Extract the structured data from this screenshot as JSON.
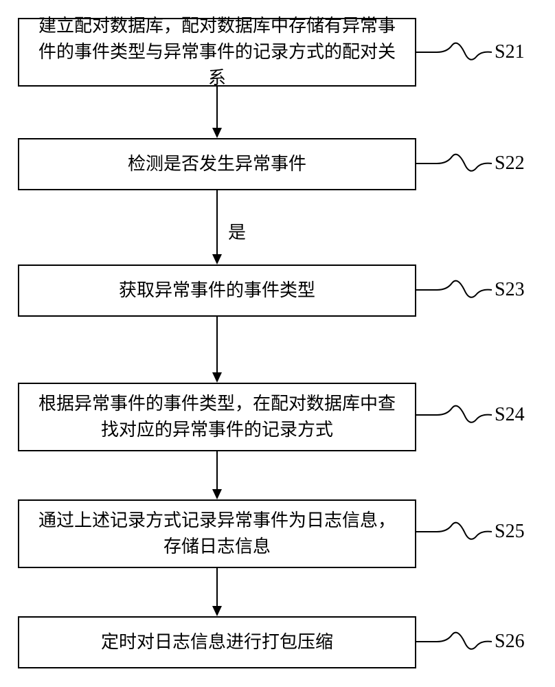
{
  "steps": [
    {
      "id": "S21",
      "text": "建立配对数据库，配对数据库中存储有异常事件的事件类型与异常事件的记录方式的配对关系"
    },
    {
      "id": "S22",
      "text": "检测是否发生异常事件"
    },
    {
      "id": "S23",
      "text": "获取异常事件的事件类型"
    },
    {
      "id": "S24",
      "text": "根据异常事件的事件类型，在配对数据库中查找对应的异常事件的记录方式"
    },
    {
      "id": "S25",
      "text": "通过上述记录方式记录异常事件为日志信息，存储日志信息"
    },
    {
      "id": "S26",
      "text": "定时对日志信息进行打包压缩"
    }
  ],
  "edge_label_yes": "是"
}
